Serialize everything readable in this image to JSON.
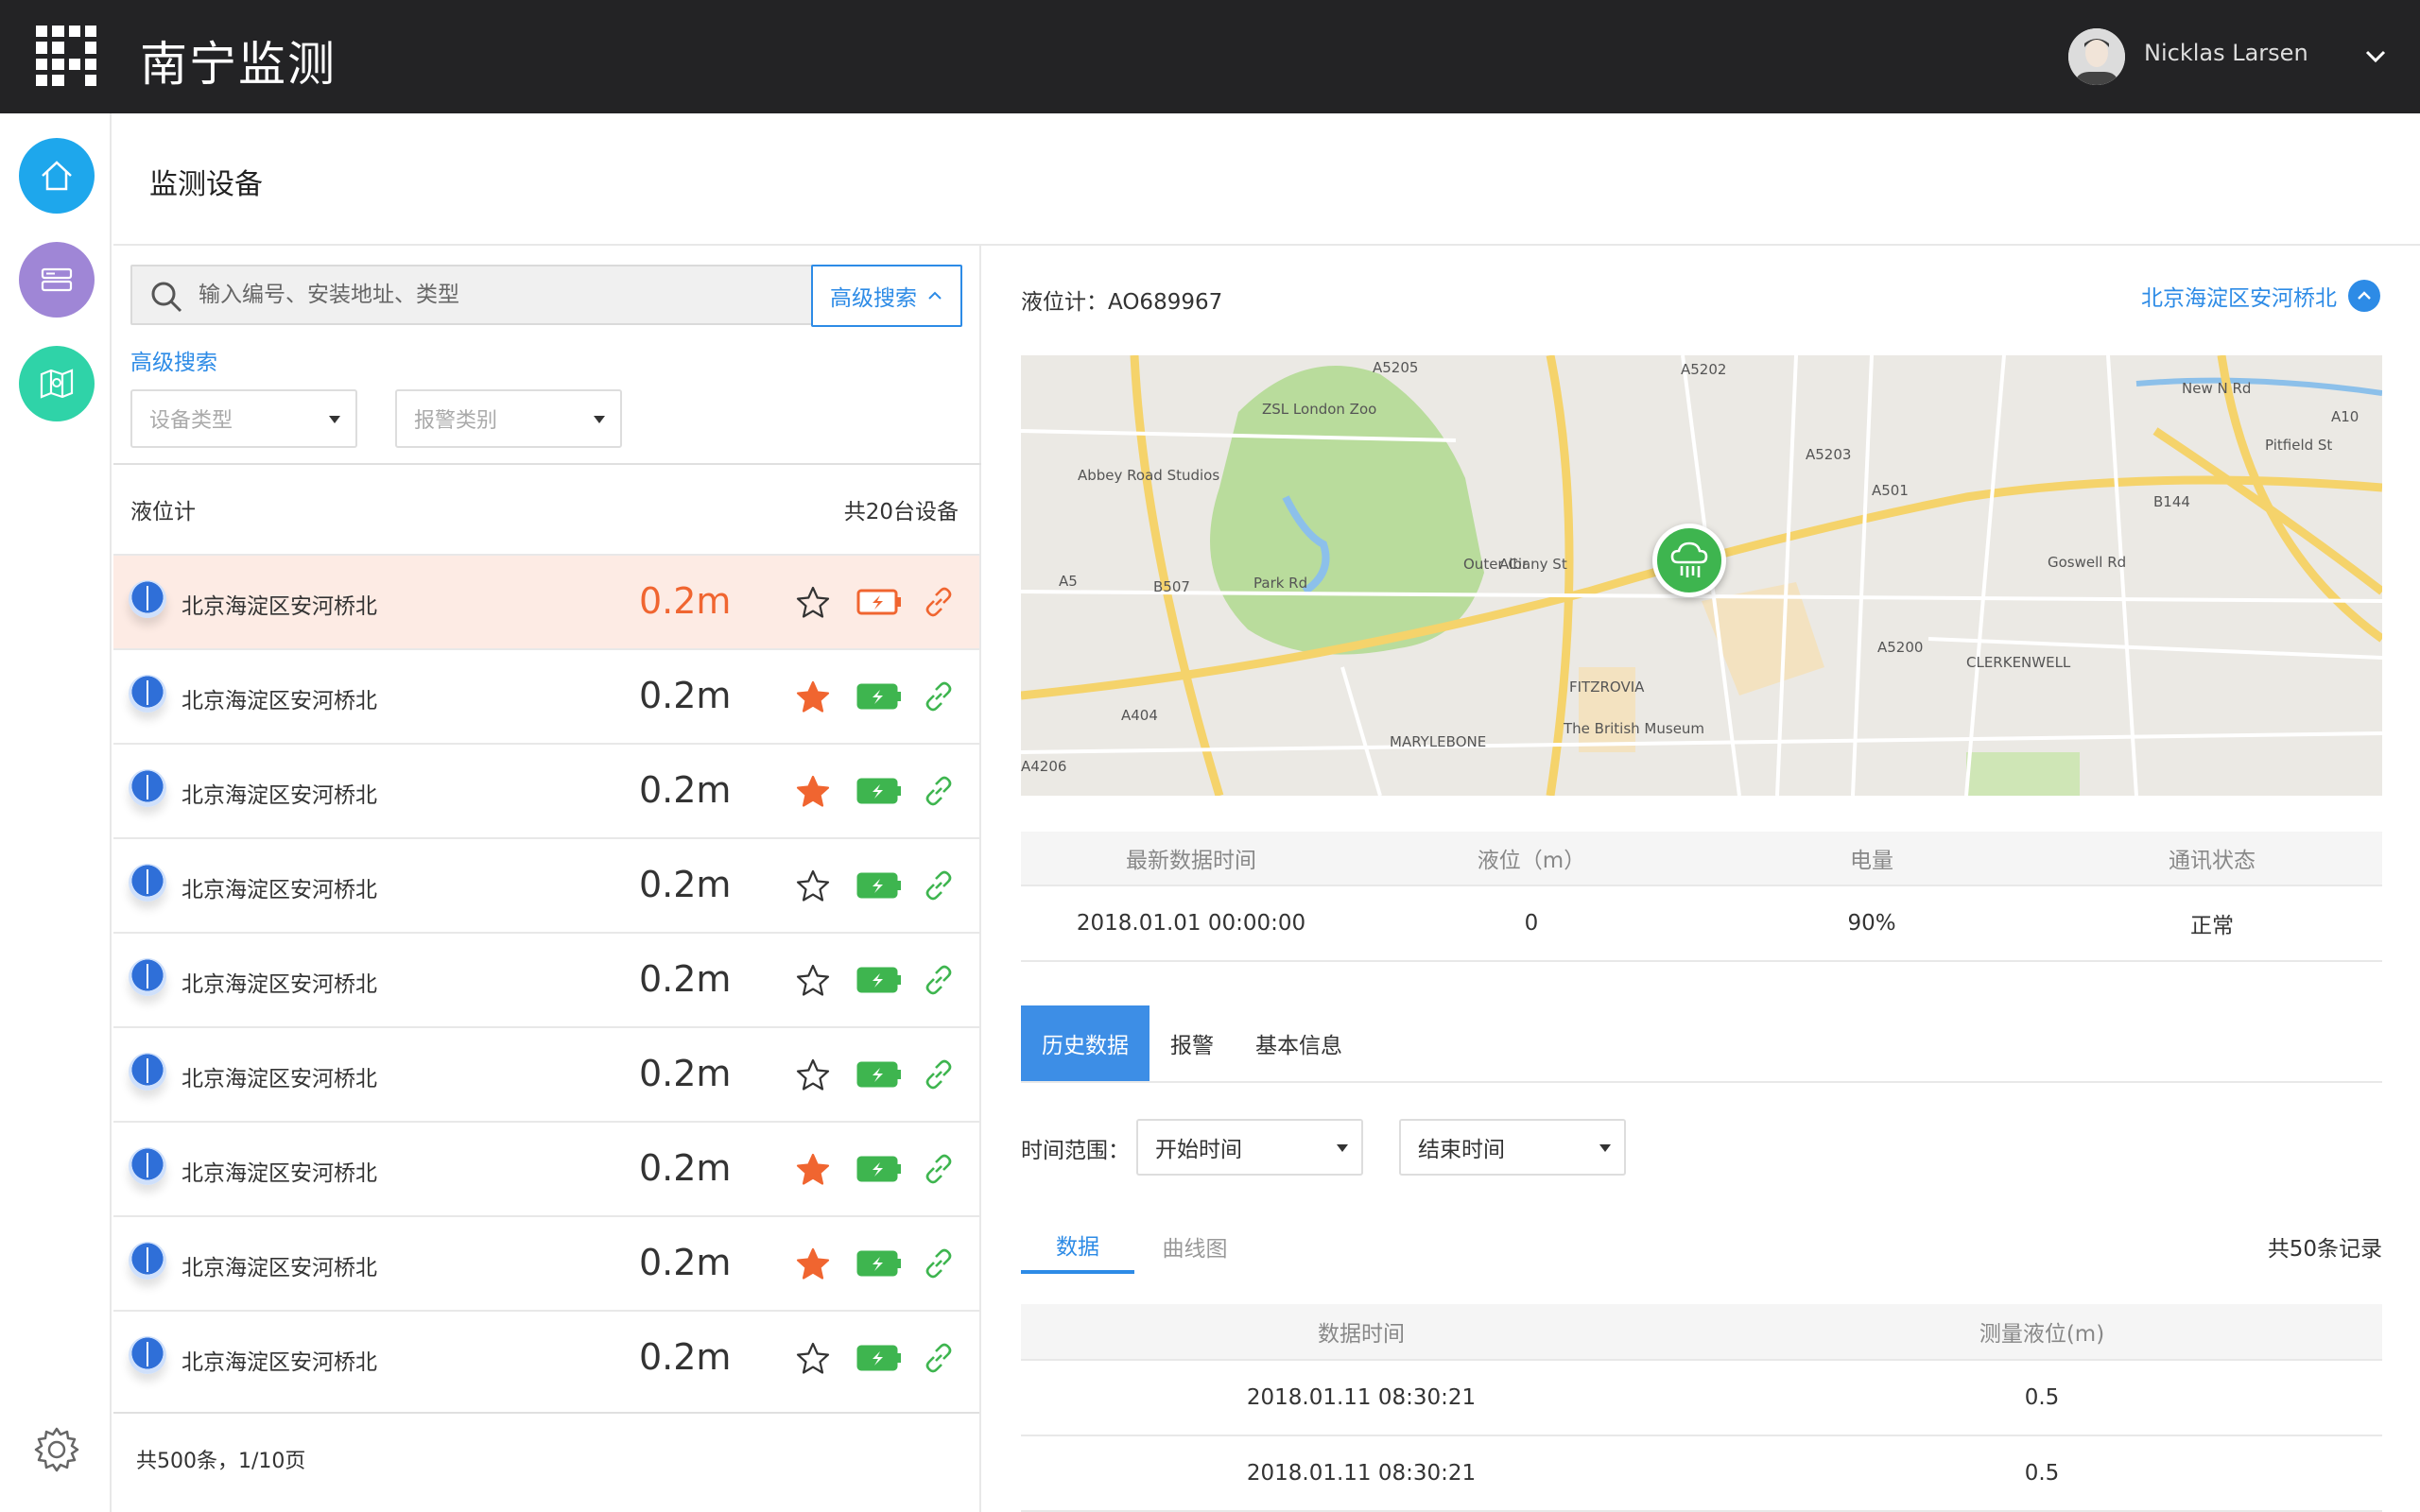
{
  "app": {
    "title": "南宁监测"
  },
  "user": {
    "name": "Nicklas Larsen"
  },
  "page": {
    "title": "监测设备"
  },
  "search": {
    "placeholder": "输入编号、安装地址、类型",
    "advanced_button": "高级搜索",
    "advanced_link": "高级搜索",
    "device_type_placeholder": "设备类型",
    "alarm_type_placeholder": "报警类别"
  },
  "list": {
    "type": "液位计",
    "count": "共20台设备",
    "items": [
      {
        "address": "北京海淀区安河桥北",
        "value": "0.2m",
        "starred": false,
        "battery": "low"
      },
      {
        "address": "北京海淀区安河桥北",
        "value": "0.2m",
        "starred": true,
        "battery": "ok"
      },
      {
        "address": "北京海淀区安河桥北",
        "value": "0.2m",
        "starred": true,
        "battery": "ok"
      },
      {
        "address": "北京海淀区安河桥北",
        "value": "0.2m",
        "starred": false,
        "battery": "ok"
      },
      {
        "address": "北京海淀区安河桥北",
        "value": "0.2m",
        "starred": false,
        "battery": "ok"
      },
      {
        "address": "北京海淀区安河桥北",
        "value": "0.2m",
        "starred": false,
        "battery": "ok"
      },
      {
        "address": "北京海淀区安河桥北",
        "value": "0.2m",
        "starred": true,
        "battery": "ok"
      },
      {
        "address": "北京海淀区安河桥北",
        "value": "0.2m",
        "starred": true,
        "battery": "ok"
      },
      {
        "address": "北京海淀区安河桥北",
        "value": "0.2m",
        "starred": false,
        "battery": "ok"
      }
    ],
    "pager": "共500条，1/10页"
  },
  "detail": {
    "device_label": "液位计：AO689967",
    "location": "北京海淀区安河桥北",
    "map_labels": [
      "ZSL London Zoo",
      "Abbey Road Studios",
      "FITZROVIA",
      "The British Museum",
      "MARYLEBONE",
      "CLERKENWELL",
      "A501",
      "A5205",
      "A404",
      "A4206",
      "A5",
      "Park Rd",
      "Albany St",
      "Outer Cir",
      "A5200",
      "A10",
      "B144",
      "Goswell Rd",
      "New N Rd",
      "Pitfield St",
      "A5202",
      "A5203",
      "B507"
    ],
    "stats": {
      "headers": [
        "最新数据时间",
        "液位（m）",
        "电量",
        "通讯状态"
      ],
      "values": [
        "2018.01.01 00:00:00",
        "0",
        "90%",
        "正常"
      ]
    },
    "tabs": [
      "历史数据",
      "报警",
      "基本信息"
    ],
    "range_label": "时间范围：",
    "start_time": "开始时间",
    "end_time": "结束时间",
    "subtabs": [
      "数据",
      "曲线图"
    ],
    "records": "共50条记录",
    "table": {
      "headers": [
        "数据时间",
        "测量液位(m)"
      ],
      "rows": [
        [
          "2018.01.11 08:30:21",
          "0.5"
        ],
        [
          "2018.01.11 08:30:21",
          "0.5"
        ]
      ]
    }
  },
  "colors": {
    "topbar": "#232325",
    "accent": "#2d8be6",
    "alert": "#f06530",
    "ok": "#3eb54f",
    "rail_home": "#1ea7ec",
    "rail_devices": "#9f86d6",
    "rail_map": "#2fd3a8"
  }
}
